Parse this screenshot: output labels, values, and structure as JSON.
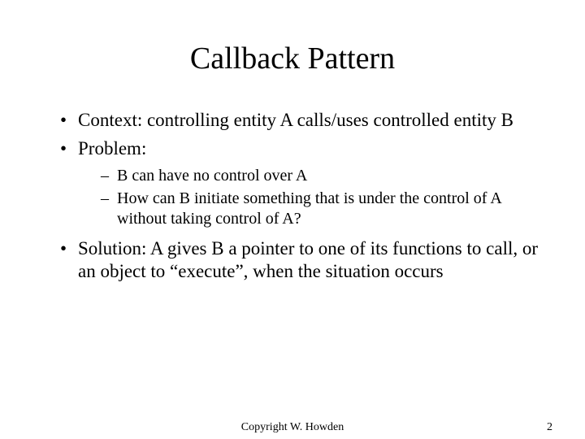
{
  "title": "Callback Pattern",
  "bullets": {
    "context": "Context:  controlling entity A calls/uses controlled entity B",
    "problem": "Problem:",
    "problem_sub1": "B can have no control over A",
    "problem_sub2": "How can B initiate something that is under the control of A without taking control of A?",
    "solution": "Solution: A gives B a pointer to one of its functions to call, or an object to “execute”, when the situation occurs"
  },
  "footer": {
    "copyright": "Copyright W. Howden",
    "page": "2"
  }
}
